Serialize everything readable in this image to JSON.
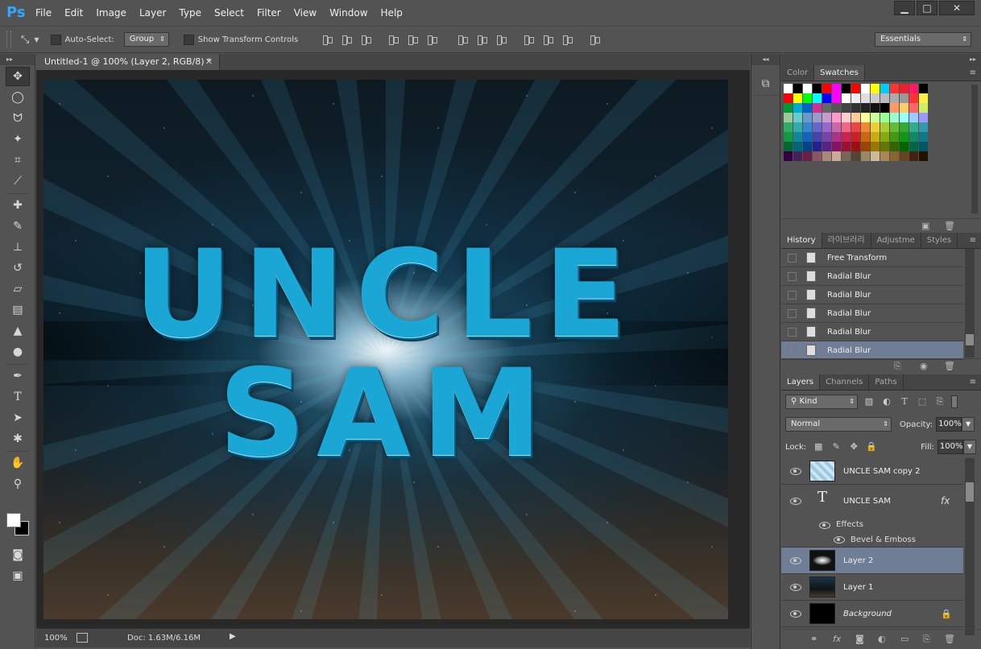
{
  "app": {
    "logo": "Ps"
  },
  "menu": [
    "File",
    "Edit",
    "Image",
    "Layer",
    "Type",
    "Select",
    "Filter",
    "View",
    "Window",
    "Help"
  ],
  "window_controls": {
    "minimize": "▁",
    "maximize": "□",
    "close": "✕"
  },
  "options_bar": {
    "auto_select_label": "Auto-Select:",
    "auto_select_value": "Group",
    "show_transform_label": "Show Transform Controls",
    "workspace": "Essentials"
  },
  "document": {
    "tab_title": "Untitled-1 @ 100% (Layer 2, RGB/8) *",
    "canvas_line1": "UNCLE",
    "canvas_line2": "SAM"
  },
  "status": {
    "zoom": "100%",
    "doc_size": "Doc: 1.63M/6.16M"
  },
  "swatches_panel": {
    "tabs": [
      "Color",
      "Swatches"
    ],
    "active_tab": "Swatches",
    "rows": [
      [
        "#ffffff",
        "#000000",
        "#ffffff",
        "#000000",
        "#ff0000",
        "#ff00ff",
        "#000000",
        "#ff0000",
        "#ffffff",
        "#ffff00",
        "#00ccff",
        "#ff3333",
        "#e8232b",
        "#ff1a66",
        "#000000"
      ],
      [
        "#ff0000",
        "#ffff00",
        "#00ff00",
        "#00ffff",
        "#0000ff",
        "#ff00ff",
        "#ffffff",
        "#eeeeee",
        "#dddddd",
        "#cccccc",
        "#bbbbbb",
        "#aaaaaa",
        "#999999",
        "#ff3333",
        "#ffee44"
      ],
      [
        "#009933",
        "#00aacc",
        "#0066cc",
        "#cc3399",
        "#666666",
        "#555555",
        "#444444",
        "#333333",
        "#222222",
        "#111111",
        "#000000",
        "#ff9966",
        "#ffcc66",
        "#ff6666",
        "#ccee66"
      ],
      [
        "#99cc99",
        "#66cccc",
        "#6699cc",
        "#9999cc",
        "#cc99cc",
        "#ff99cc",
        "#ffcccc",
        "#ffcc99",
        "#ffff99",
        "#ccff99",
        "#99ff99",
        "#99ffcc",
        "#99ffff",
        "#99ccff",
        "#9999ff"
      ],
      [
        "#33aa66",
        "#33aaaa",
        "#3388cc",
        "#6666cc",
        "#9966cc",
        "#cc66aa",
        "#ee6688",
        "#ee4444",
        "#ee8833",
        "#eecc33",
        "#aacc33",
        "#66bb33",
        "#33aa33",
        "#33aa88",
        "#3399aa"
      ],
      [
        "#119944",
        "#118899",
        "#1166bb",
        "#4444aa",
        "#7744aa",
        "#aa3388",
        "#cc2255",
        "#cc2222",
        "#cc6611",
        "#ccaa11",
        "#88aa11",
        "#449911",
        "#119911",
        "#118866",
        "#117788"
      ],
      [
        "#006633",
        "#006677",
        "#004488",
        "#222288",
        "#552288",
        "#881166",
        "#991133",
        "#991111",
        "#994400",
        "#997700",
        "#667700",
        "#336600",
        "#006600",
        "#006644",
        "#005566"
      ],
      [
        "#330044",
        "#442255",
        "#662244",
        "#885566",
        "#aa8877",
        "#ccaa99",
        "#776655",
        "#554433",
        "#998866",
        "#ccbb99",
        "#aa8855",
        "#886633",
        "#664422",
        "#442211",
        "#221100"
      ]
    ]
  },
  "history_panel": {
    "tabs": [
      "History",
      "라이브러리",
      "Adjustme",
      "Styles"
    ],
    "active_tab": "History",
    "items": [
      "Free Transform",
      "Radial Blur",
      "Radial Blur",
      "Radial Blur",
      "Radial Blur",
      "Radial Blur"
    ],
    "selected_index": 5
  },
  "layers_panel": {
    "tabs": [
      "Layers",
      "Channels",
      "Paths"
    ],
    "active_tab": "Layers",
    "filter_kind": "Kind",
    "blend_mode": "Normal",
    "opacity_label": "Opacity:",
    "opacity_value": "100%",
    "lock_label": "Lock:",
    "fill_label": "Fill:",
    "fill_value": "100%",
    "layers": [
      {
        "name": "UNCLE SAM copy 2",
        "type": "pixel"
      },
      {
        "name": "UNCLE SAM",
        "type": "text",
        "fx": "fx"
      },
      {
        "name": "Layer 2",
        "type": "pixel",
        "selected": true
      },
      {
        "name": "Layer 1",
        "type": "pixel"
      },
      {
        "name": "Background",
        "type": "background"
      }
    ],
    "effects_label": "Effects",
    "effect_name": "Bevel & Emboss"
  }
}
